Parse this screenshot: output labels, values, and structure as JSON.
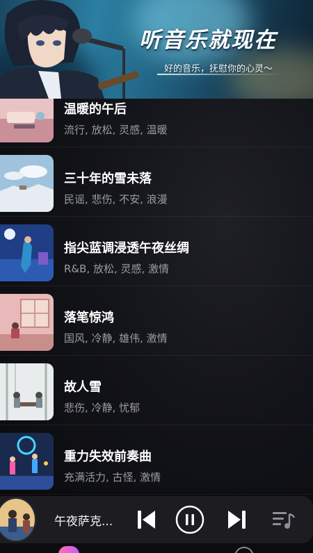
{
  "banner": {
    "title": "听音乐就现在",
    "subtitle": "好的音乐，抚慰你的心灵～"
  },
  "songs": [
    {
      "title": "温暖的午后",
      "tags": "流行, 放松, 灵感, 温暖",
      "cover": "cozy-room-cover"
    },
    {
      "title": "三十年的雪未落",
      "tags": "民谣, 悲伤, 不安, 浪漫",
      "cover": "snowy-field-cover"
    },
    {
      "title": "指尖蓝调浸透午夜丝绸",
      "tags": "R&B, 放松, 灵感, 激情",
      "cover": "night-bedroom-cover"
    },
    {
      "title": "落笔惊鸿",
      "tags": "国风, 冷静, 雄伟, 激情",
      "cover": "chinese-room-cover"
    },
    {
      "title": "故人雪",
      "tags": "悲伤, 冷静, 忧郁",
      "cover": "snow-bamboo-cover"
    },
    {
      "title": "重力失效前奏曲",
      "tags": "充满活力, 古怪, 激情",
      "cover": "dancers-cover"
    }
  ],
  "player": {
    "now_playing": "午夜萨克...",
    "state": "playing"
  },
  "colors": {
    "background": "#0b0b10",
    "tag_text": "#9a9ca4",
    "player_bg": "#1c1c21"
  }
}
